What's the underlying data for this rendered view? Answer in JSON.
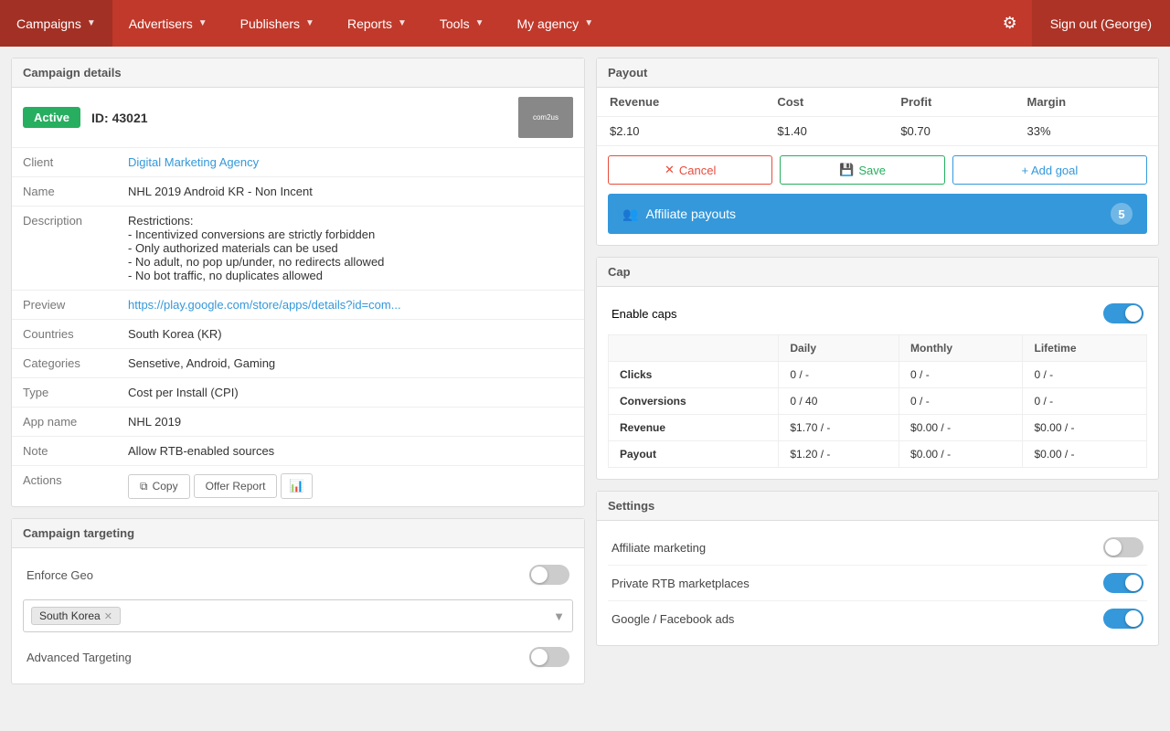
{
  "nav": {
    "campaigns_label": "Campaigns",
    "advertisers_label": "Advertisers",
    "publishers_label": "Publishers",
    "reports_label": "Reports",
    "tools_label": "Tools",
    "myagency_label": "My agency",
    "signout_label": "Sign out (George)"
  },
  "campaign_details": {
    "panel_title": "Campaign details",
    "status_badge": "Active",
    "id_label": "ID: 43021",
    "thumb_text": "com2us",
    "fields": [
      {
        "key": "Client",
        "value": "Digital Marketing Agency",
        "is_link": true
      },
      {
        "key": "Name",
        "value": "NHL 2019 Android KR - Non Incent",
        "is_link": false
      },
      {
        "key": "Description",
        "value": "Restrictions:\n- Incentivized conversions are strictly forbidden\n- Only authorized materials can be used\n- No adult, no pop up/under, no redirects allowed\n- No bot traffic, no duplicates allowed",
        "is_link": false
      },
      {
        "key": "Preview",
        "value": "https://play.google.com/store/apps/details?id=com...",
        "is_link": true
      },
      {
        "key": "Countries",
        "value": "South Korea (KR)",
        "is_link": false
      },
      {
        "key": "Categories",
        "value": "Sensetive, Android, Gaming",
        "is_link": false
      },
      {
        "key": "Type",
        "value": "Cost per Install (CPI)",
        "is_link": false
      },
      {
        "key": "App name",
        "value": "NHL 2019",
        "is_link": false
      },
      {
        "key": "Note",
        "value": "Allow RTB-enabled sources",
        "is_link": false
      }
    ],
    "actions_key": "Actions",
    "copy_btn": "Copy",
    "offer_report_btn": "Offer Report"
  },
  "campaign_targeting": {
    "panel_title": "Campaign targeting",
    "enforce_geo_label": "Enforce Geo",
    "enforce_geo_on": false,
    "geo_tags": [
      "South Korea"
    ],
    "advanced_targeting_label": "Advanced Targeting",
    "advanced_targeting_on": false
  },
  "payout": {
    "panel_title": "Payout",
    "columns": [
      "Revenue",
      "Cost",
      "Profit",
      "Margin"
    ],
    "values": [
      "$2.10",
      "$1.40",
      "$0.70",
      "33%"
    ],
    "cancel_btn": "Cancel",
    "save_btn": "Save",
    "addgoal_btn": "+ Add goal",
    "affiliate_payouts_btn": "Affiliate payouts",
    "affiliate_count": "5"
  },
  "cap": {
    "panel_title": "Cap",
    "enable_caps_label": "Enable caps",
    "enable_caps_on": true,
    "columns": [
      "",
      "Daily",
      "Monthly",
      "Lifetime"
    ],
    "rows": [
      {
        "label": "Clicks",
        "daily": "0 / -",
        "monthly": "0 / -",
        "lifetime": "0 / -"
      },
      {
        "label": "Conversions",
        "daily": "0 / 40",
        "monthly": "0 / -",
        "lifetime": "0 / -"
      },
      {
        "label": "Revenue",
        "daily": "$1.70 / -",
        "monthly": "$0.00 / -",
        "lifetime": "$0.00 / -"
      },
      {
        "label": "Payout",
        "daily": "$1.20 / -",
        "monthly": "$0.00 / -",
        "lifetime": "$0.00 / -"
      }
    ]
  },
  "settings": {
    "panel_title": "Settings",
    "rows": [
      {
        "label": "Affiliate marketing",
        "on": false
      },
      {
        "label": "Private RTB marketplaces",
        "on": true
      },
      {
        "label": "Google / Facebook ads",
        "on": true
      }
    ]
  }
}
